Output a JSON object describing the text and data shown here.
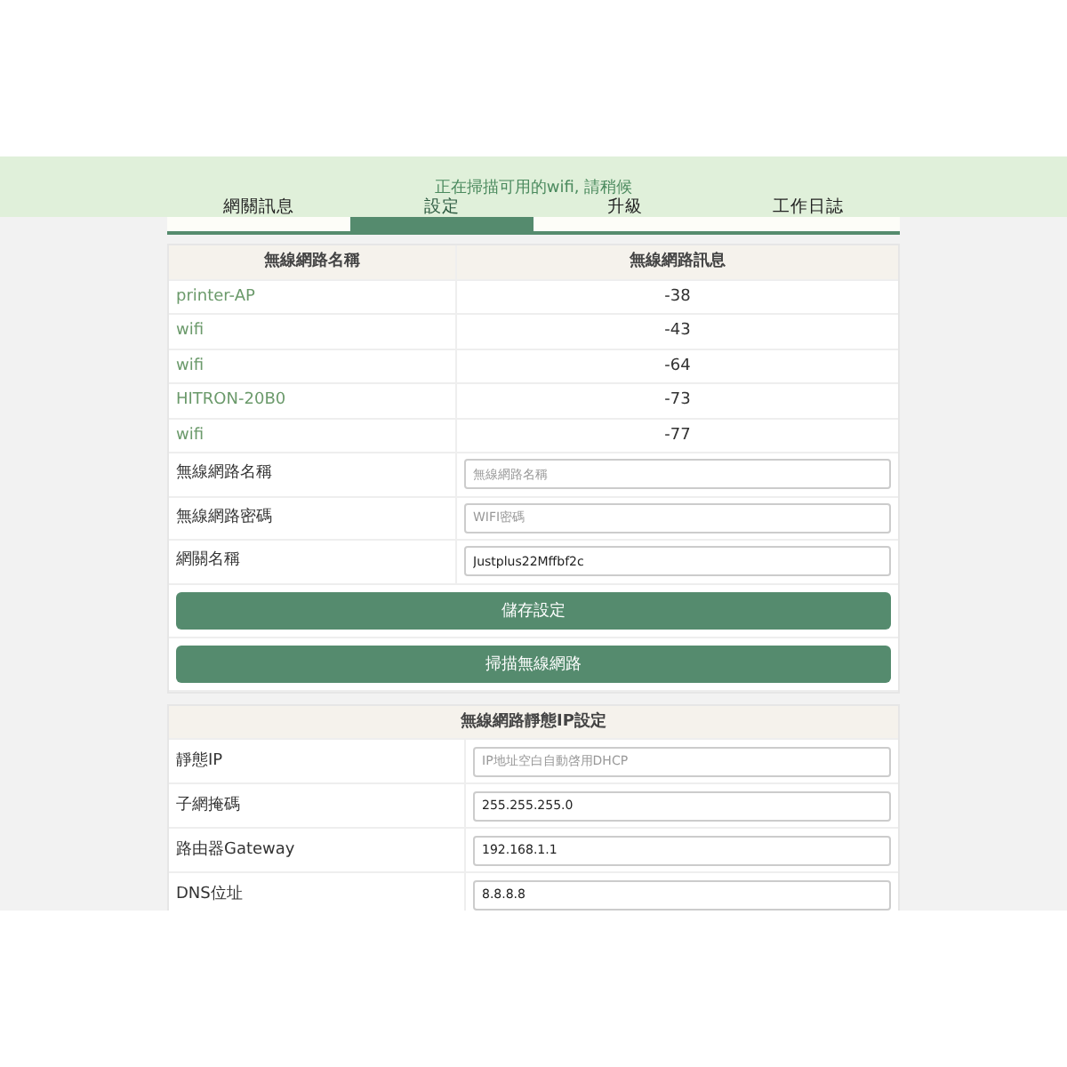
{
  "banner": {
    "message": "正在掃描可用的wifi, 請稍候"
  },
  "tabs": [
    {
      "label": "網關訊息",
      "selected": false
    },
    {
      "label": "設定",
      "selected": true
    },
    {
      "label": "升級",
      "selected": false
    },
    {
      "label": "工作日誌",
      "selected": false
    }
  ],
  "wifi_table": {
    "columns": [
      "無線網路名稱",
      "無線網路訊息"
    ],
    "rows": [
      {
        "ssid": "printer-AP",
        "signal": "-38"
      },
      {
        "ssid": "wifi",
        "signal": "-43"
      },
      {
        "ssid": "wifi",
        "signal": "-64"
      },
      {
        "ssid": "HITRON-20B0",
        "signal": "-73"
      },
      {
        "ssid": "wifi",
        "signal": "-77"
      }
    ]
  },
  "wifi_form": [
    {
      "label": "無線網路名稱",
      "placeholder": "無線網路名稱"
    },
    {
      "label": "無線網路密碼",
      "placeholder": "WIFI密碼"
    },
    {
      "label": "網關名稱",
      "value": "Justplus22Mffbf2c"
    }
  ],
  "buttons": [
    "儲存設定",
    "掃描無線網路"
  ],
  "static_ip": {
    "title": "無線網路靜態IP設定",
    "fields": [
      {
        "label": "靜態IP",
        "placeholder": "IP地址空白自動啓用DHCP"
      },
      {
        "label": "子網掩碼",
        "value": "255.255.255.0"
      },
      {
        "label": "路由器Gateway",
        "value": "192.168.1.1"
      },
      {
        "label": "DNS位址",
        "value": "8.8.8.8"
      }
    ]
  }
}
